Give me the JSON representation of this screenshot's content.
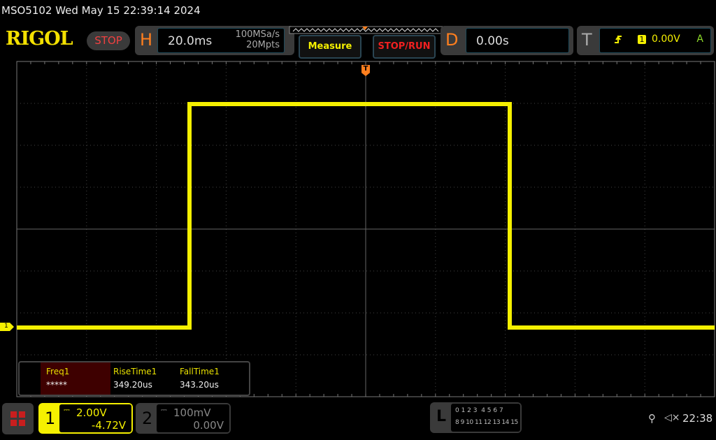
{
  "title": "MSO5102  Wed May 15 22:39:14 2024",
  "logo": "RIGOL",
  "run_state": "STOP",
  "horizontal": {
    "letter": "H",
    "timebase": "20.0ms",
    "sample_rate": "100MSa/s",
    "memory_depth": "20Mpts"
  },
  "buttons": {
    "measure": "Measure",
    "stop_run": "STOP/RUN"
  },
  "delay": {
    "letter": "D",
    "value": "0.00s"
  },
  "trigger": {
    "letter": "T",
    "source": "1",
    "level": "0.00V",
    "mode": "A",
    "icon": "rising-edge-icon"
  },
  "trigger_marker": "T",
  "channel_marker": "1",
  "measurements": [
    {
      "label": "Freq1",
      "value": "*****"
    },
    {
      "label": "RiseTime1",
      "value": "349.20us"
    },
    {
      "label": "FallTime1",
      "value": "343.20us"
    }
  ],
  "channels": [
    {
      "number": "1",
      "scale": "2.00V",
      "offset": "-4.72V",
      "color": "#f5f000"
    },
    {
      "number": "2",
      "scale": "100mV",
      "offset": "0.00V",
      "color": "#888888"
    }
  ],
  "logic": {
    "letter": "L",
    "row1": "0 1 2 3  4 5 6 7",
    "row2": "8 9 10 11 12 13 14 15"
  },
  "status": {
    "time": "22:38",
    "usb_icon": "usb-icon",
    "sound_icon": "mute-icon"
  },
  "colors": {
    "trace": "#f5f000",
    "accent": "#ff7f1e"
  }
}
